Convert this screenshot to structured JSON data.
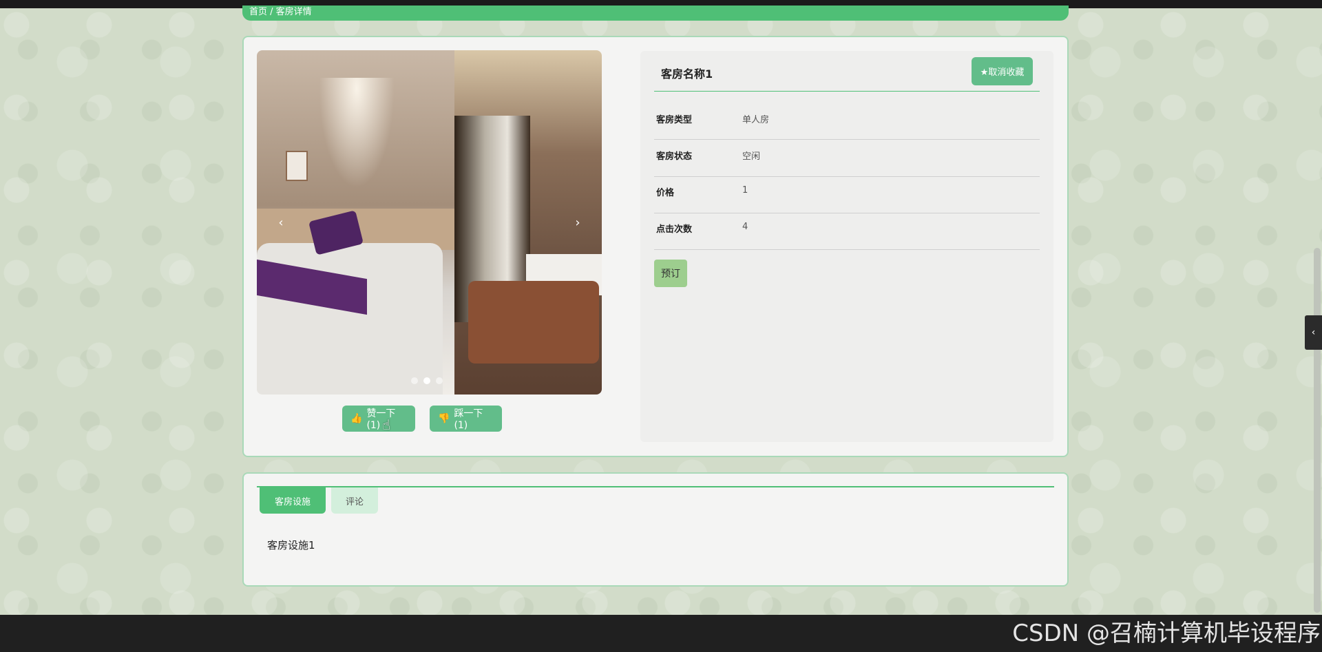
{
  "breadcrumb": "首页 / 客房详情",
  "room": {
    "title": "客房名称1",
    "unfavorite_label": "★取消收藏",
    "fields": [
      {
        "label": "客房类型",
        "value": "单人房"
      },
      {
        "label": "客房状态",
        "value": "空闲"
      },
      {
        "label": "价格",
        "value": "1"
      },
      {
        "label": "点击次数",
        "value": "4"
      }
    ],
    "book_label": "预订"
  },
  "carousel": {
    "prev": "‹",
    "next": "›",
    "active_slide": 2,
    "slide_count": 3
  },
  "votes": {
    "like_label": "赞一下(1)",
    "dislike_label": "踩一下(1)",
    "like_icon": "thumbs-up-icon",
    "dislike_icon": "thumbs-down-icon"
  },
  "tabs": [
    {
      "label": "客房设施",
      "active": true
    },
    {
      "label": "评论",
      "active": false
    }
  ],
  "tab_content": "客房设施1",
  "side_toggle": "‹",
  "watermark": "CSDN @召楠计算机毕设程序",
  "colors": {
    "accent": "#4fbf76",
    "button": "#62bd8a",
    "book_button": "#9dce8e",
    "tab_inactive": "#d3efdc"
  }
}
